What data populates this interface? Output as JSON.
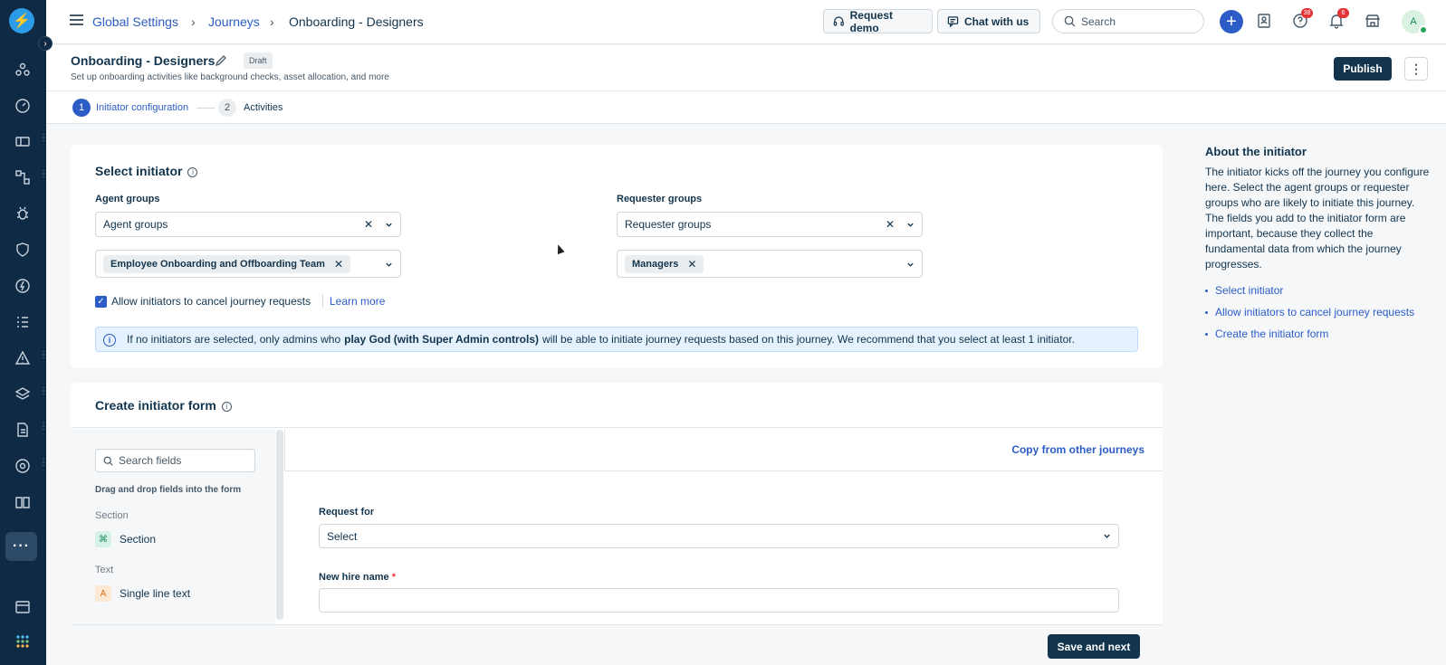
{
  "breadcrumb": {
    "root": "Global Settings",
    "mid": "Journeys",
    "current": "Onboarding - Designers"
  },
  "topbar": {
    "request_demo": "Request demo",
    "chat": "Chat with us",
    "search_placeholder": "Search",
    "help_badge": "38",
    "notif_badge": "6",
    "avatar": "A"
  },
  "header": {
    "title": "Onboarding - Designers",
    "status": "Draft",
    "subtitle": "Set up onboarding activities like background checks, asset allocation, and more",
    "publish": "Publish"
  },
  "stepper": [
    {
      "num": "1",
      "label": "Initiator configuration"
    },
    {
      "num": "2",
      "label": "Activities"
    }
  ],
  "select_initiator": {
    "title": "Select initiator",
    "agent_groups_label": "Agent groups",
    "agent_groups_value": "Agent groups",
    "agent_chip": "Employee Onboarding and Offboarding Team",
    "requester_groups_label": "Requester groups",
    "requester_groups_value": "Requester groups",
    "requester_chip": "Managers",
    "allow_cancel": "Allow initiators to cancel journey requests",
    "learn_more": "Learn more",
    "alert_pre": "If no initiators are selected, only admins who",
    "alert_bold": "play God (with Super Admin controls)",
    "alert_post": "will be able to initiate journey requests based on this journey. We recommend that you select at least 1 initiator."
  },
  "initiator_form": {
    "title": "Create initiator form",
    "search_placeholder": "Search fields",
    "drag_hint": "Drag and drop fields into the form",
    "copy_link": "Copy from other journeys",
    "group_section": "Section",
    "item_section": "Section",
    "group_text": "Text",
    "item_single": "Single line text",
    "request_for_label": "Request for",
    "request_for_value": "Select",
    "new_hire_label": "New hire name",
    "required_mark": "*",
    "save_next": "Save and next"
  },
  "about": {
    "title": "About the initiator",
    "text": "The initiator kicks off the journey you configure here. Select the agent groups or requester groups who are likely to initiate this journey. The fields you add to the initiator form are important, because they collect the fundamental data from which the journey progresses.",
    "links": [
      "Select initiator",
      "Allow initiators to cancel journey requests",
      "Create the initiator form"
    ]
  }
}
